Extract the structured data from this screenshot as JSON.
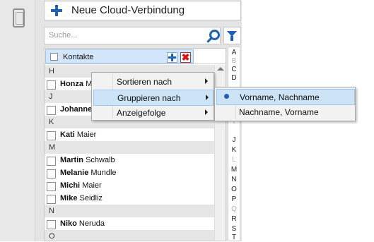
{
  "toolbar": {
    "new_cloud_label": "Neue Cloud-Verbindung"
  },
  "search": {
    "placeholder": "Suche..."
  },
  "list": {
    "header_label": "Kontakte",
    "rows": [
      {
        "type": "group",
        "text": "H"
      },
      {
        "type": "contact",
        "first": "Honza",
        "last": "M"
      },
      {
        "type": "group",
        "text": "J"
      },
      {
        "type": "contact",
        "first": "Johanne",
        "last": ""
      },
      {
        "type": "group",
        "text": "K"
      },
      {
        "type": "contact",
        "first": "Kati",
        "last": "Maier"
      },
      {
        "type": "group",
        "text": "M"
      },
      {
        "type": "contact",
        "first": "Martin",
        "last": "Schwalb"
      },
      {
        "type": "contact",
        "first": "Melanie",
        "last": "Mundle"
      },
      {
        "type": "contact",
        "first": "Michi",
        "last": "Maier"
      },
      {
        "type": "contact",
        "first": "Mike",
        "last": "Seidliz"
      },
      {
        "type": "group",
        "text": "N"
      },
      {
        "type": "contact",
        "first": "Niko",
        "last": "Neruda"
      },
      {
        "type": "group",
        "text": "O"
      }
    ]
  },
  "alphabet": [
    {
      "letter": "A",
      "active": true
    },
    {
      "letter": "B",
      "active": false
    },
    {
      "letter": "C",
      "active": true
    },
    {
      "letter": "D",
      "active": true
    },
    {
      "letter": "I",
      "active": false
    },
    {
      "letter": "J",
      "active": true
    },
    {
      "letter": "K",
      "active": true
    },
    {
      "letter": "L",
      "active": false
    },
    {
      "letter": "M",
      "active": true
    },
    {
      "letter": "N",
      "active": true
    },
    {
      "letter": "O",
      "active": true
    },
    {
      "letter": "P",
      "active": true
    },
    {
      "letter": "Q",
      "active": false
    },
    {
      "letter": "R",
      "active": true
    },
    {
      "letter": "S",
      "active": true
    },
    {
      "letter": "T",
      "active": true
    }
  ],
  "context_menu": {
    "items": [
      {
        "label": "Sortieren nach",
        "highlighted": false
      },
      {
        "label": "Gruppieren nach",
        "highlighted": true
      },
      {
        "label": "Anzeigefolge",
        "highlighted": false
      }
    ]
  },
  "submenu": {
    "items": [
      {
        "label": "Vorname, Nachname",
        "selected": true
      },
      {
        "label": "Nachname, Vorname",
        "selected": false
      }
    ]
  },
  "colors": {
    "accent": "#1f5fb8",
    "highlight": "#cde4f7",
    "group_bg": "#e6e6e6",
    "inactive_letter": "#b0b0b0"
  }
}
